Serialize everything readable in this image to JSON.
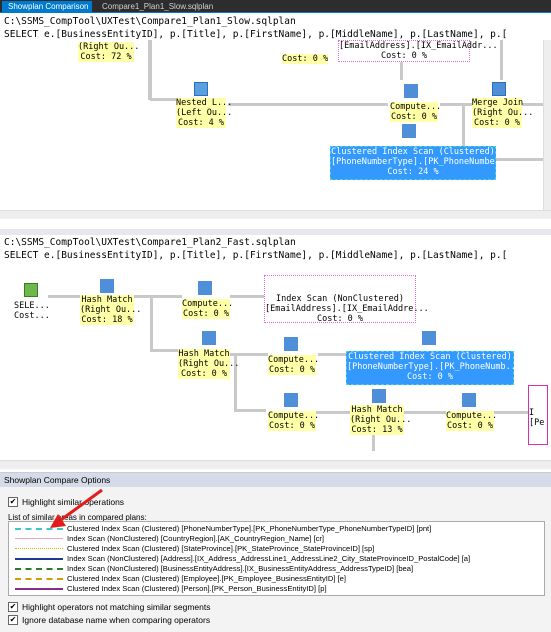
{
  "tabs": [
    {
      "label": "Showplan Comparison"
    },
    {
      "label": "Compare1_Plan1_Slow.sqlplan"
    }
  ],
  "plan1": {
    "path": "C:\\SSMS_CompTool\\UXTest\\Compare1_Plan1_Slow.sqlplan",
    "query": "SELECT e.[BusinessEntityID], p.[Title], p.[FirstName], p.[MiddleName], p.[LastName], p.[",
    "ops": [
      {
        "l1": "(Right Ou...",
        "l2": "Cost: 72 %"
      },
      {
        "l1": "[EmailAddress].[IX_EmailAddr...",
        "l2": "Cost: 0 %"
      },
      {
        "l1": "Nested L...",
        "l2": "(Left Ou...",
        "l3": "Cost: 4 %"
      },
      {
        "l1": "Compute...",
        "l2": "Cost: 0 %"
      },
      {
        "l1": "Merge Join",
        "l2": "(Right Ou...",
        "l3": "Cost: 0 %"
      },
      {
        "l1": "Cost: 0 %"
      },
      {
        "l1": "Clustered Index Scan (Clustered)",
        "l2": "[PhoneNumberType].[PK_PhoneNumbe...",
        "l3": "Cost: 24 %"
      }
    ]
  },
  "plan2": {
    "path": "C:\\SSMS_CompTool\\UXTest\\Compare1_Plan2_Fast.sqlplan",
    "query": "SELECT e.[BusinessEntityID], p.[Title], p.[FirstName], p.[MiddleName], p.[LastName], p.[",
    "ops": [
      {
        "l1": "SELE...",
        "l2": "Cost..."
      },
      {
        "l1": "Hash Match",
        "l2": "(Right Ou...",
        "l3": "Cost: 18 %"
      },
      {
        "l1": "Compute...",
        "l2": "Cost: 0 %"
      },
      {
        "l1": "Index Scan (NonClustered)",
        "l2": "[EmailAddress].[IX_EmailAddre...",
        "l3": "Cost: 0 %"
      },
      {
        "l1": "Hash Match",
        "l2": "(Right Ou...",
        "l3": "Cost: 0 %"
      },
      {
        "l1": "Compute...",
        "l2": "Cost: 0 %"
      },
      {
        "l1": "Clustered Index Scan (Clustered)",
        "l2": "[PhoneNumberType].[PK_PhoneNumb...",
        "l3": "Cost: 0 %"
      },
      {
        "l1": "Compute...",
        "l2": "Cost: 0 %"
      },
      {
        "l1": "Hash Match",
        "l2": "(Right Ou...",
        "l3": "Cost: 13 %"
      },
      {
        "l1": "Compute...",
        "l2": "Cost: 0 %"
      },
      {
        "l1": "I",
        "l2": "[Pe"
      }
    ]
  },
  "options": {
    "title": "Showplan Compare Options",
    "highlight_similar": "Highlight similar operations",
    "list_label": "List of similar areas in compared plans:",
    "items": [
      {
        "text": "Clustered Index Scan (Clustered) [PhoneNumberType].[PK_PhoneNumberType_PhoneNumberTypeID] [pnt]",
        "color": "#3cc8c8",
        "style": "dashed"
      },
      {
        "text": "Index Scan (NonClustered) [CountryRegion].[AK_CountryRegion_Name] [cr]",
        "color": "#f4a6b8",
        "style": "solid"
      },
      {
        "text": "Clustered Index Scan (Clustered) [StateProvince].[PK_StateProvince_StateProvinceID] [sp]",
        "color": "#e0b000",
        "style": "dotted"
      },
      {
        "text": "Index Scan (NonClustered) [Address].[IX_Address_AddressLine1_AddressLine2_City_StateProvinceID_PostalCode] [a]",
        "color": "#1f3a93",
        "style": "solid"
      },
      {
        "text": "Index Scan (NonClustered) [BusinessEntityAddress].[IX_BusinessEntityAddress_AddressTypeID] [bea]",
        "color": "#2d7a2d",
        "style": "dashed"
      },
      {
        "text": "Clustered Index Scan (Clustered) [Employee].[PK_Employee_BusinessEntityID] [e]",
        "color": "#d49a00",
        "style": "dashed"
      },
      {
        "text": "Clustered Index Scan (Clustered) [Person].[PK_Person_BusinessEntityID] [p]",
        "color": "#8a2a8a",
        "style": "solid"
      }
    ],
    "highlight_not_matching": "Highlight operators not matching similar segments",
    "ignore_db_name": "Ignore database name when comparing operators",
    "checked": "✔"
  }
}
